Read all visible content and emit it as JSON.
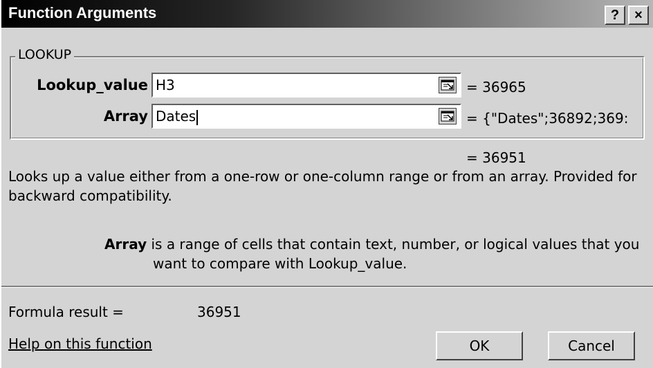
{
  "window": {
    "title": "Function Arguments",
    "help_glyph": "?",
    "close_glyph": "×"
  },
  "function_group": {
    "legend": "LOOKUP",
    "args": [
      {
        "label": "Lookup_value",
        "value": "H3",
        "result": "= 36965"
      },
      {
        "label": "Array",
        "value": "Dates",
        "result": "= {\"Dates\";36892;369:"
      }
    ]
  },
  "overall_result": "= 36951",
  "description": {
    "line1": "Looks up a value either from a one-row or one-column range or from an array. Provided for",
    "line2": "backward compatibility."
  },
  "arg_help": {
    "name": "Array",
    "line1": " is a range of cells that contain text, number, or logical values that you",
    "line2": "want to compare with Lookup_value."
  },
  "formula": {
    "label": "Formula result =",
    "value": "36951"
  },
  "help_link": "Help on this function",
  "buttons": {
    "ok": "OK",
    "cancel": "Cancel"
  },
  "icons": {
    "collapse": "collapse-dialog-icon"
  }
}
